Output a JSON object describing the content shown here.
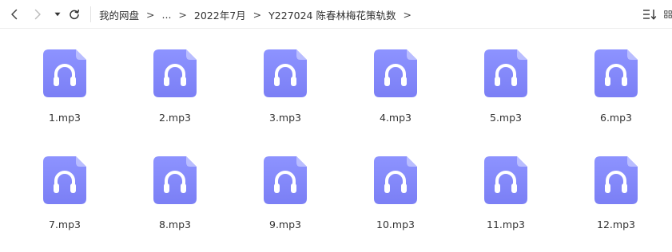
{
  "breadcrumb": [
    {
      "label": "我的网盘"
    },
    {
      "label": "..."
    },
    {
      "label": "2022年7月"
    },
    {
      "label": "Y227024 陈春林梅花策轨数"
    }
  ],
  "breadcrumb_separator": ">",
  "colors": {
    "icon_top": "#8d93ff",
    "icon_bottom": "#7b7ff5",
    "icon_fold": "#b9bdff",
    "toolbar_border": "#ececec"
  },
  "files": [
    {
      "name": "1.mp3",
      "type": "audio"
    },
    {
      "name": "2.mp3",
      "type": "audio"
    },
    {
      "name": "3.mp3",
      "type": "audio"
    },
    {
      "name": "4.mp3",
      "type": "audio"
    },
    {
      "name": "5.mp3",
      "type": "audio"
    },
    {
      "name": "6.mp3",
      "type": "audio"
    },
    {
      "name": "7.mp3",
      "type": "audio"
    },
    {
      "name": "8.mp3",
      "type": "audio"
    },
    {
      "name": "9.mp3",
      "type": "audio"
    },
    {
      "name": "10.mp3",
      "type": "audio"
    },
    {
      "name": "11.mp3",
      "type": "audio"
    },
    {
      "name": "12.mp3",
      "type": "audio"
    }
  ],
  "icons": {
    "back": "chevron-left-icon",
    "forward": "chevron-right-icon",
    "dropdown": "caret-down-icon",
    "refresh": "refresh-icon",
    "sort": "sort-icon",
    "view": "grid-view-icon",
    "file": "headphones-icon"
  }
}
